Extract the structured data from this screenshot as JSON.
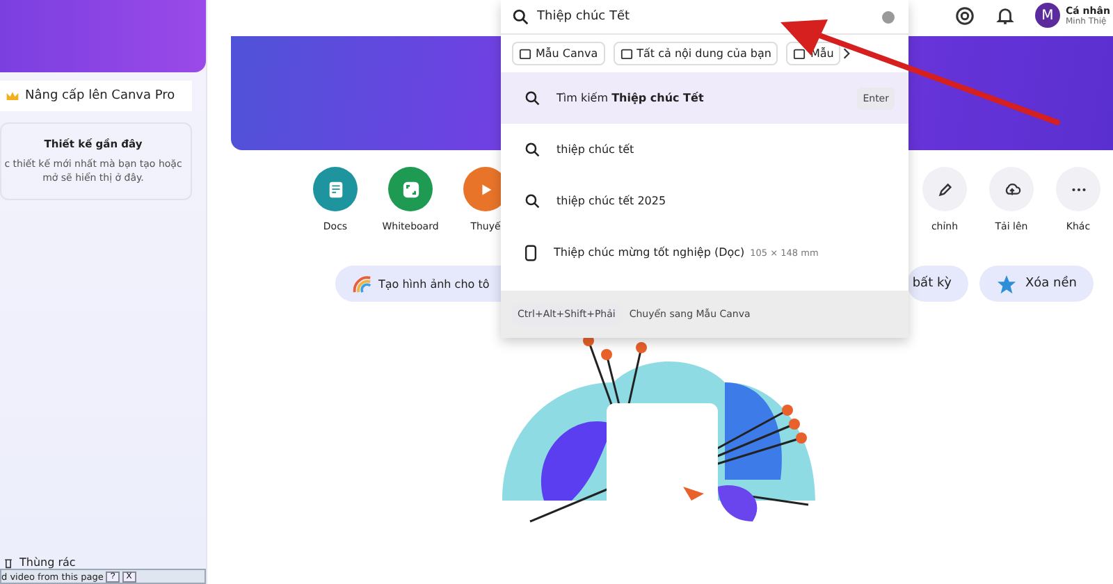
{
  "sidebar": {
    "upgrade_label": "Nâng cấp lên Canva Pro",
    "recent_title": "Thiết kế gần đây",
    "recent_text": "c thiết kế mới nhất mà bạn tạo hoặc mở sẽ hiển thị ở đây.",
    "trash_label": "Thùng rác"
  },
  "header": {
    "avatar_initial": "M",
    "account_name": "Cá nhân",
    "account_user": "Minh Thiệ"
  },
  "search": {
    "value": "Thiệp chúc Tết",
    "filters": [
      "Mẫu Canva",
      "Tất cả nội dung của bạn",
      "Mẫu"
    ],
    "suggestions": [
      {
        "kind": "search",
        "text": "Tìm kiếm **Thiệp chúc Tết**",
        "shortcut": "Enter",
        "selected": true
      },
      {
        "kind": "search",
        "text": "thiệp chúc tết",
        "selected": false
      },
      {
        "kind": "search",
        "text": "thiệp chúc tết 2025",
        "selected": false
      },
      {
        "kind": "design",
        "text": "Thiệp chúc mừng tốt nghiệp (Dọc)",
        "size": "105 × 148 mm",
        "selected": false
      }
    ],
    "footer_keys": "Ctrl+Alt+Shift+Phải",
    "footer_text": "Chuyển sang Mẫu Canva"
  },
  "shortcuts_left": [
    {
      "kind": "docs",
      "label": "Docs",
      "color": "#1e949f"
    },
    {
      "kind": "whiteboard",
      "label": "Whiteboard",
      "color": "#1f9a52"
    },
    {
      "kind": "video",
      "label": "Thuyế",
      "color": "#e8742a"
    }
  ],
  "shortcuts_right": [
    {
      "kind": "edit",
      "label": "chỉnh"
    },
    {
      "kind": "upload",
      "label": "Tải lên"
    },
    {
      "kind": "more",
      "label": "Khác"
    }
  ],
  "tools": [
    {
      "kind": "image-gen",
      "label": "Tạo hình ảnh cho tô"
    },
    {
      "kind": "plain",
      "label": "bất kỳ"
    },
    {
      "kind": "remove-bg",
      "label": "Xóa nền"
    }
  ],
  "browser_bar": {
    "text": "d video from this page",
    "buttons": [
      "?",
      "X"
    ]
  }
}
